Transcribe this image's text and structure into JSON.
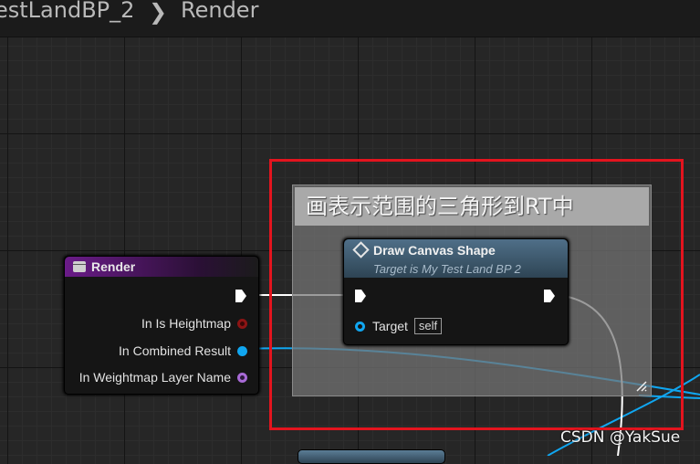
{
  "breadcrumb": {
    "parent": "estLandBP_2",
    "current": "Render"
  },
  "comment": {
    "title": "画表示范围的三角形到RT中"
  },
  "render_node": {
    "title": "Render",
    "pins": {
      "heightmap": "In Is Heightmap",
      "combined": "In Combined Result",
      "layer_name": "In Weightmap Layer Name"
    }
  },
  "draw_node": {
    "title": "Draw Canvas Shape",
    "subtitle": "Target is My Test Land BP 2",
    "target_label": "Target",
    "target_value": "self"
  },
  "watermark": "CSDN @YakSue",
  "colors": {
    "highlight_box": "#e3141e",
    "object_pin": "#10a6f0",
    "exec_wire": "#ffffff",
    "function_header": "#6a1b88"
  }
}
